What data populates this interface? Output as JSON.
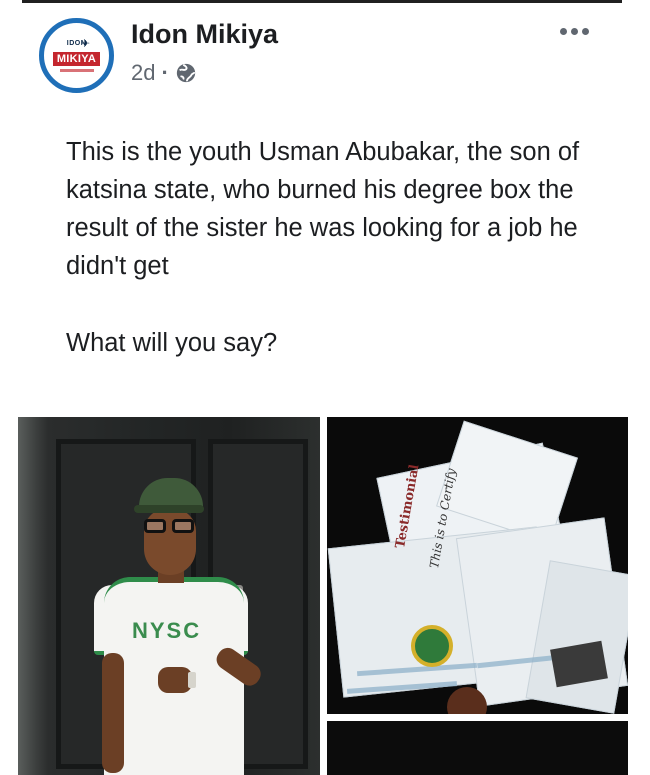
{
  "post": {
    "author": "Idon Mikiya",
    "time": "2d",
    "separator": "·",
    "avatar": {
      "logo_top": "IDON",
      "logo_main": "MIKIYA"
    },
    "text": "This is the youth Usman Abubakar, the son of katsina state, who burned his degree box the result of the sister he was looking for a job he didn't get",
    "question": "What will you say?"
  },
  "photos": {
    "left": {
      "shirt_text": "NYSC"
    },
    "right_top": {
      "certificate_word": "Testimonial",
      "certificate_script": "This is to Certify"
    }
  },
  "icons": {
    "globe": "globe-icon",
    "more": "more-options-icon"
  },
  "colors": {
    "avatar_ring": "#1f6fb8",
    "logo_red": "#c4262e",
    "meta_gray": "#606770",
    "text": "#1c1e21",
    "nysc_green": "#3a8c4e"
  }
}
